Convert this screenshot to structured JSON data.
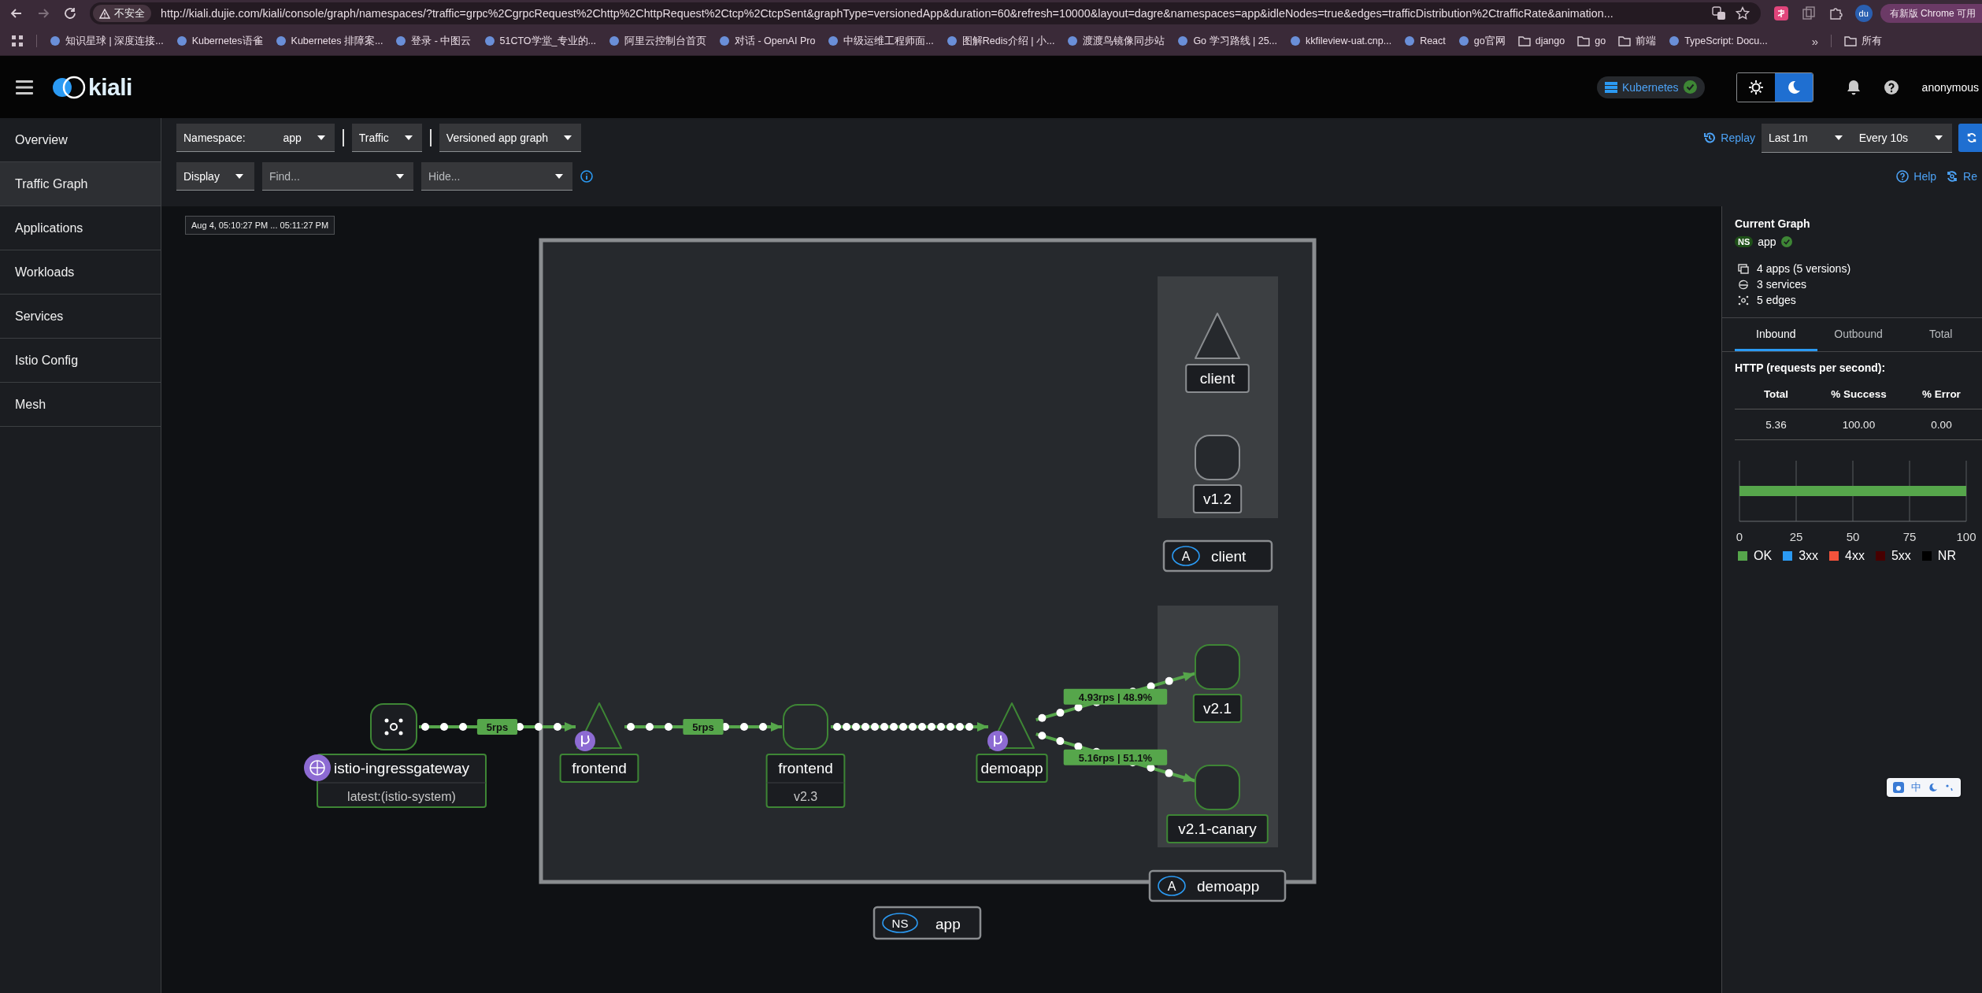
{
  "browser": {
    "security": "不安全",
    "url": "http://kiali.dujie.com/kiali/console/graph/namespaces/?traffic=grpc%2CgrpcRequest%2Chttp%2ChttpRequest%2Ctcp%2CtcpSent&graphType=versionedApp&duration=60&refresh=10000&layout=dagre&namespaces=app&idleNodes=true&edges=trafficDistribution%2CtrafficRate&animation...",
    "profile": "du",
    "update": "有新版 Chrome 可用"
  },
  "bookmarks": [
    {
      "label": "知识星球 | 深度连接..."
    },
    {
      "label": "Kubernetes语雀"
    },
    {
      "label": "Kubernetes 排障案..."
    },
    {
      "label": "登录 - 中图云"
    },
    {
      "label": "51CTO学堂_专业的..."
    },
    {
      "label": "阿里云控制台首页"
    },
    {
      "label": "对话 - OpenAI Pro"
    },
    {
      "label": "中级运维工程师面..."
    },
    {
      "label": "图解Redis介绍 | 小..."
    },
    {
      "label": "渡渡鸟镜像同步站"
    },
    {
      "label": "Go 学习路线 | 25..."
    },
    {
      "label": "kkfileview-uat.cnp..."
    },
    {
      "label": "React"
    },
    {
      "label": "go官网"
    },
    {
      "label": "django",
      "kind": "folder"
    },
    {
      "label": "go",
      "kind": "folder"
    },
    {
      "label": "前端",
      "kind": "folder"
    },
    {
      "label": "TypeScript: Docu..."
    }
  ],
  "bookmarks_more": "»",
  "all_bookmarks": "所有",
  "header": {
    "logo": "kiali",
    "cluster": "Kubernetes",
    "theme": [
      {
        "kind": "light",
        "selected": false
      },
      {
        "kind": "dark",
        "selected": true
      }
    ],
    "user": "anonymous"
  },
  "sidebar": {
    "items": [
      {
        "label": "Overview",
        "selected": false
      },
      {
        "label": "Traffic Graph",
        "selected": true
      },
      {
        "label": "Applications",
        "selected": false
      },
      {
        "label": "Workloads",
        "selected": false
      },
      {
        "label": "Services",
        "selected": false
      },
      {
        "label": "Istio Config",
        "selected": false
      },
      {
        "label": "Mesh",
        "selected": false
      }
    ]
  },
  "toolbar": {
    "namespace_label": "Namespace:",
    "namespace": "app",
    "traffic": "Traffic",
    "graph_type": "Versioned app graph",
    "display": "Display",
    "find_placeholder": "Find...",
    "hide_placeholder": "Hide...",
    "replay": "Replay",
    "duration": "Last 1m",
    "refresh": "Every 10s",
    "help": "Help",
    "reset": "Re"
  },
  "graph": {
    "time_range": "Aug 4, 05:10:27 PM ... 05:11:27 PM",
    "namespace_box": {
      "badge": "NS",
      "label": "app"
    },
    "app_boxes": [
      {
        "badge": "A",
        "label": "client"
      },
      {
        "badge": "A",
        "label": "demoapp"
      }
    ],
    "nodes": [
      {
        "kind": "gateway",
        "label": "istio-ingressgateway",
        "sublabel": "latest:(istio-system)",
        "idle": false
      },
      {
        "kind": "app",
        "label": "frontend",
        "idle": false,
        "virtual_service": true
      },
      {
        "kind": "workload",
        "label": "frontend",
        "sublabel": "v2.3",
        "idle": false
      },
      {
        "kind": "app",
        "label": "demoapp",
        "idle": false,
        "virtual_service": true
      },
      {
        "kind": "app",
        "label": "client",
        "idle": true
      },
      {
        "kind": "workload",
        "label": "v1.2",
        "idle": true
      },
      {
        "kind": "workload",
        "label": "v2.1",
        "idle": false
      },
      {
        "kind": "workload",
        "label": "v2.1-canary",
        "idle": false
      }
    ],
    "edges": [
      {
        "label": "5rps"
      },
      {
        "label": "5rps"
      },
      {
        "kind": "dense"
      },
      {
        "label": "4.93rps | 48.9%"
      },
      {
        "label": "5.16rps | 51.1%"
      }
    ]
  },
  "side_panel": {
    "title": "Current Graph",
    "namespace_badge": "NS",
    "namespace": "app",
    "stats": [
      {
        "kind": "apps",
        "label": "4 apps (5 versions)"
      },
      {
        "kind": "services",
        "label": "3 services"
      },
      {
        "kind": "edges",
        "label": "5 edges"
      }
    ],
    "tabs": [
      {
        "label": "Inbound",
        "selected": true
      },
      {
        "label": "Outbound",
        "selected": false
      },
      {
        "label": "Total",
        "selected": false
      }
    ],
    "http_title": "HTTP (requests per second):",
    "columns": [
      "Total",
      "% Success",
      "% Error"
    ],
    "row": [
      "5.36",
      "100.00",
      "0.00"
    ],
    "chart_data": {
      "type": "bar",
      "orientation": "horizontal",
      "stacked": true,
      "grid": true,
      "xticks": [
        0,
        25,
        50,
        75,
        100
      ],
      "xlim": [
        0,
        100
      ],
      "series": [
        {
          "name": "OK",
          "color": "#56a64b",
          "values": [
            100
          ]
        },
        {
          "name": "3xx",
          "color": "#2b9af3",
          "values": [
            0
          ]
        },
        {
          "name": "4xx",
          "color": "#f4523b",
          "values": [
            0
          ]
        },
        {
          "name": "5xx",
          "color": "#470000",
          "values": [
            0
          ]
        },
        {
          "name": "NR",
          "color": "#000000",
          "values": [
            0
          ]
        }
      ]
    }
  },
  "ime_toolbar": {
    "mode": "中"
  }
}
